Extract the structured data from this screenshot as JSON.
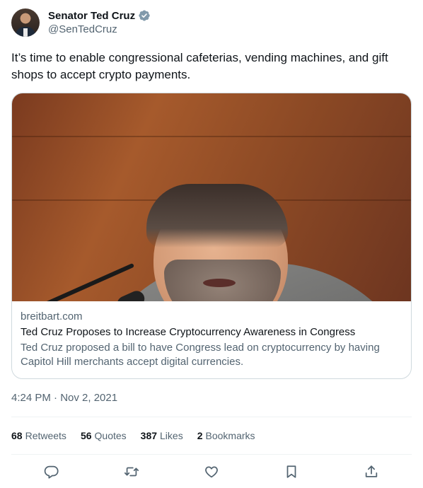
{
  "author": {
    "display_name": "Senator Ted Cruz",
    "handle": "@SenTedCruz",
    "verified_icon": "verified-badge-icon",
    "verified_color": "#829aab"
  },
  "tweet": {
    "text": "It’s time to enable congressional cafeterias, vending machines, and gift shops to accept crypto payments."
  },
  "card": {
    "image_icon": "article-photo",
    "domain": "breitbart.com",
    "title": "Ted Cruz Proposes to Increase Cryptocurrency Awareness in Congress",
    "description": "Ted Cruz proposed a bill to have Congress lead on cryptocurrency by having Capitol Hill merchants accept digital currencies."
  },
  "timestamp": "4:24 PM · Nov 2, 2021",
  "stats": [
    {
      "count": "68",
      "label": "Retweets"
    },
    {
      "count": "56",
      "label": "Quotes"
    },
    {
      "count": "387",
      "label": "Likes"
    },
    {
      "count": "2",
      "label": "Bookmarks"
    }
  ],
  "actions": [
    {
      "icon": "reply-icon"
    },
    {
      "icon": "retweet-icon"
    },
    {
      "icon": "like-icon"
    },
    {
      "icon": "bookmark-icon"
    },
    {
      "icon": "share-icon"
    }
  ],
  "colors": {
    "text_primary": "#0f1419",
    "text_secondary": "#536471",
    "border": "#cfd9de",
    "divider": "#eff3f4"
  }
}
